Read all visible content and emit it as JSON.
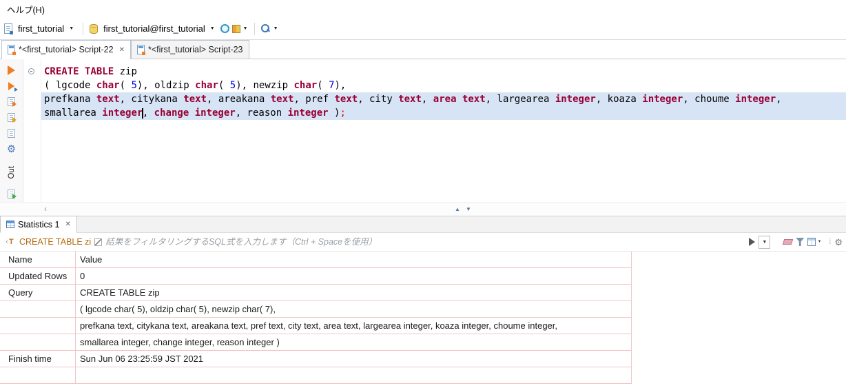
{
  "menubar": {
    "help": "ヘルプ(H)"
  },
  "toolbar": {
    "connection": "first_tutorial",
    "database": "first_tutorial@first_tutorial"
  },
  "editor_tabs": [
    {
      "label": "*<first_tutorial> Script-22",
      "active": true,
      "closable": true
    },
    {
      "label": "*<first_tutorial> Script-23",
      "active": false,
      "closable": false
    }
  ],
  "editor": {
    "out_label": "Out",
    "lines": [
      {
        "highlight": false,
        "segments": [
          [
            "kw",
            "CREATE TABLE"
          ],
          [
            "pl",
            " zip"
          ]
        ]
      },
      {
        "highlight": false,
        "segments": [
          [
            "pl",
            "( lgcode "
          ],
          [
            "kw",
            "char"
          ],
          [
            "pl",
            "( "
          ],
          [
            "num",
            "5"
          ],
          [
            "pl",
            "), oldzip "
          ],
          [
            "kw",
            "char"
          ],
          [
            "pl",
            "( "
          ],
          [
            "num",
            "5"
          ],
          [
            "pl",
            "), newzip "
          ],
          [
            "kw",
            "char"
          ],
          [
            "pl",
            "( "
          ],
          [
            "num",
            "7"
          ],
          [
            "pl",
            "),"
          ]
        ]
      },
      {
        "highlight": true,
        "segments": [
          [
            "pl",
            "prefkana "
          ],
          [
            "kw",
            "text"
          ],
          [
            "pl",
            ", citykana "
          ],
          [
            "kw",
            "text"
          ],
          [
            "pl",
            ", areakana "
          ],
          [
            "kw",
            "text"
          ],
          [
            "pl",
            ", pref "
          ],
          [
            "kw",
            "text"
          ],
          [
            "pl",
            ", city "
          ],
          [
            "kw",
            "text"
          ],
          [
            "pl",
            ", "
          ],
          [
            "kw",
            "area"
          ],
          [
            "pl",
            " "
          ],
          [
            "kw",
            "text"
          ],
          [
            "pl",
            ", largearea "
          ],
          [
            "kw",
            "integer"
          ],
          [
            "pl",
            ", koaza "
          ],
          [
            "kw",
            "integer"
          ],
          [
            "pl",
            ", choume "
          ],
          [
            "kw",
            "integer"
          ],
          [
            "pl",
            ","
          ]
        ]
      },
      {
        "highlight": true,
        "segments": [
          [
            "pl",
            "smallarea "
          ],
          [
            "kw",
            "integer"
          ],
          [
            "caret",
            ""
          ],
          [
            "pl",
            ", "
          ],
          [
            "kw",
            "change"
          ],
          [
            "pl",
            " "
          ],
          [
            "kw",
            "integer"
          ],
          [
            "pl",
            ", reason "
          ],
          [
            "kw",
            "integer"
          ],
          [
            "pl",
            " )"
          ],
          [
            "delim",
            ";"
          ]
        ]
      }
    ]
  },
  "stats": {
    "tab_label": "Statistics 1"
  },
  "filterbar": {
    "query_ref": "CREATE TABLE zi",
    "placeholder": "結果をフィルタリングするSQL式を入力します（Ctrl + Spaceを使用）"
  },
  "results": {
    "columns": [
      "Name",
      "Value"
    ],
    "rows": [
      [
        "Updated Rows",
        "0"
      ],
      [
        "Query",
        "CREATE TABLE zip"
      ],
      [
        "",
        "( lgcode char( 5), oldzip char( 5), newzip char( 7),"
      ],
      [
        "",
        "prefkana text, citykana text, areakana text, pref text, city text, area text, largearea integer, koaza integer, choume integer,"
      ],
      [
        "",
        "smallarea integer, change integer, reason integer )"
      ],
      [
        "Finish time",
        "Sun Jun 06 23:25:59 JST 2021"
      ],
      [
        "",
        ""
      ]
    ]
  },
  "icons": {
    "caret_down": "▼",
    "close": "✕",
    "gear": "⚙",
    "scroll_left": "‹",
    "collapse_up": "▲",
    "collapse_down": "▼",
    "dots": "⁞"
  },
  "colors": {
    "keyword": "#990033",
    "number": "#0000e6",
    "delimiter": "#e00000",
    "line_highlight": "#d6e4f5",
    "grid_line": "#f0c6c6",
    "accent_orange": "#ef7d23",
    "accent_blue": "#3a76b8",
    "filter_query": "#b5680f",
    "placeholder": "#9aa0a6"
  }
}
